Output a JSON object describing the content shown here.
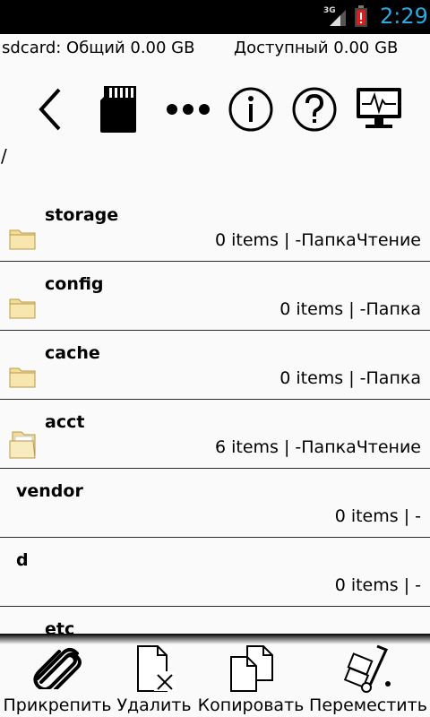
{
  "status_bar": {
    "network": "3G",
    "time": "2:29"
  },
  "storage": {
    "total_label": "sdcard: Общий 0.00 GB",
    "available_label": "Доступный 0.00 GB"
  },
  "toolbar": {
    "icons": [
      "back-arrow-icon",
      "sdcard-icon",
      "more-dots-icon",
      "info-icon",
      "help-icon",
      "monitor-icon"
    ]
  },
  "path": "/",
  "items": [
    {
      "name": "storage",
      "info": "0 items | -ПапкаЧтение",
      "icon": "folder-icon"
    },
    {
      "name": "config",
      "info": "0 items | -Папка",
      "icon": "folder-icon"
    },
    {
      "name": "cache",
      "info": "0 items | -Папка",
      "icon": "folder-icon"
    },
    {
      "name": "acct",
      "info": "6 items | -ПапкаЧтение",
      "icon": "folder-open-icon"
    },
    {
      "name": "vendor",
      "info": "0 items | -"
    },
    {
      "name": "d",
      "info": "0 items | -"
    },
    {
      "name": "etc",
      "info": ""
    }
  ],
  "bottom_actions": [
    {
      "label": "Прикрепить",
      "icon": "paperclip-icon"
    },
    {
      "label": "Удалить",
      "icon": "delete-file-icon"
    },
    {
      "label": "Копировать",
      "icon": "copy-icon"
    },
    {
      "label": "Переместить",
      "icon": "hand-truck-icon"
    }
  ],
  "colors": {
    "clock": "#2aa8e0",
    "battery_alert": "#d32020",
    "folder": "#f2dc98"
  }
}
